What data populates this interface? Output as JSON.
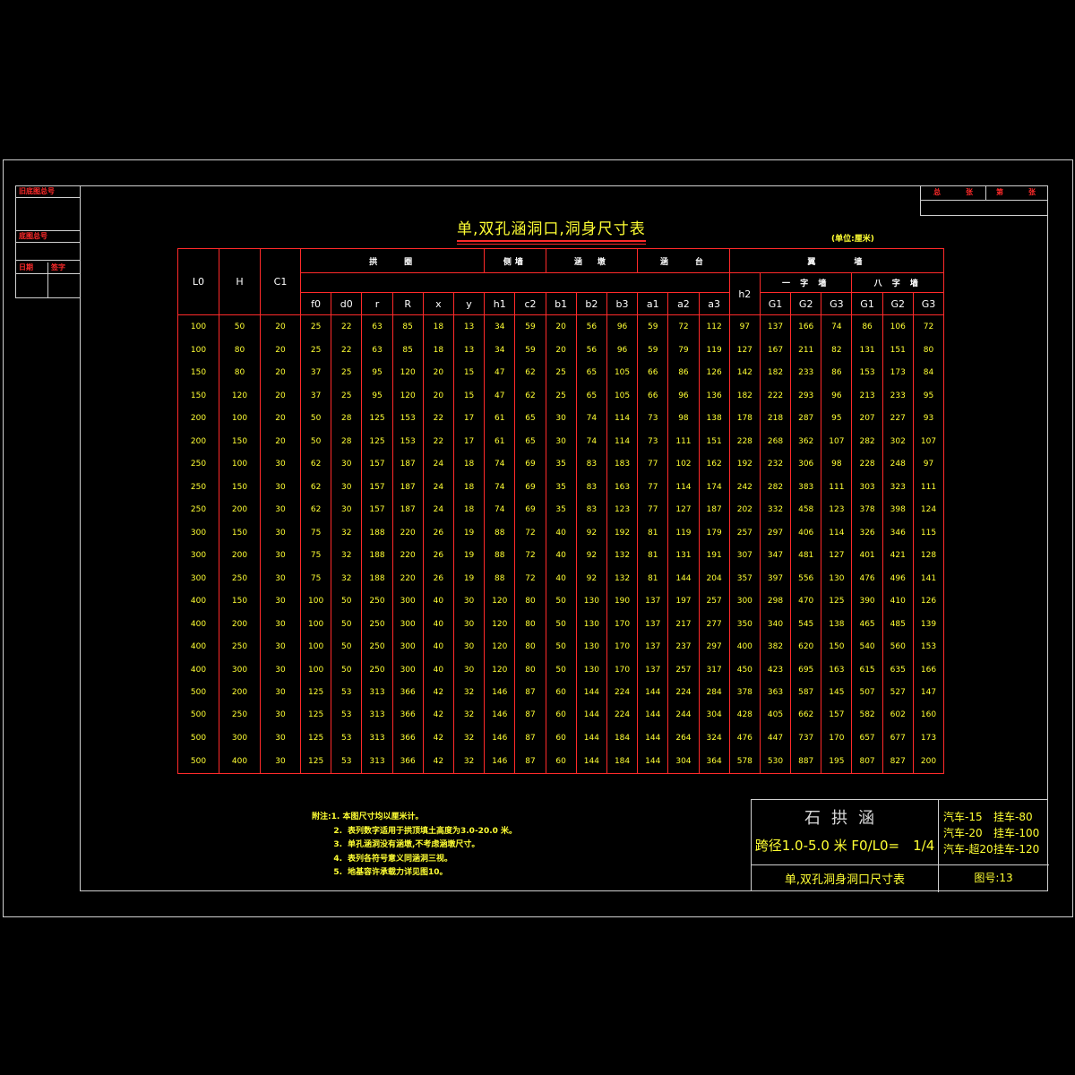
{
  "stamp": {
    "cell1": "旧底图总号",
    "cell2": "底图总号",
    "cell3a": "日期",
    "cell3b": "签字"
  },
  "top_right": {
    "label1": "总",
    "label2": "张",
    "label3": "第",
    "label4": "张"
  },
  "title": "单,双孔涵洞口,洞身尺寸表",
  "unit": "(单位:厘米)",
  "table": {
    "col_left": [
      "L0",
      "H",
      "C1"
    ],
    "groups": [
      "拱　　圈",
      "侧墙",
      "涵　墩",
      "涵　　台",
      "翼　　　墙"
    ],
    "wing_sub": [
      "一 字 墙",
      "八 字 墙"
    ],
    "cols": [
      "f0",
      "d0",
      "r",
      "R",
      "x",
      "y",
      "h1",
      "c2",
      "b1",
      "b2",
      "b3",
      "a1",
      "a2",
      "a3",
      "h2",
      "G1",
      "G2",
      "G3",
      "G1",
      "G2",
      "G3"
    ],
    "rows": [
      [
        "100",
        "50",
        "20",
        "25",
        "22",
        "63",
        "85",
        "18",
        "13",
        "34",
        "59",
        "20",
        "56",
        "96",
        "59",
        "72",
        "112",
        "97",
        "137",
        "166",
        "74",
        "86",
        "106",
        "72"
      ],
      [
        "100",
        "80",
        "20",
        "25",
        "22",
        "63",
        "85",
        "18",
        "13",
        "34",
        "59",
        "20",
        "56",
        "96",
        "59",
        "79",
        "119",
        "127",
        "167",
        "211",
        "82",
        "131",
        "151",
        "80"
      ],
      [
        "150",
        "80",
        "20",
        "37",
        "25",
        "95",
        "120",
        "20",
        "15",
        "47",
        "62",
        "25",
        "65",
        "105",
        "66",
        "86",
        "126",
        "142",
        "182",
        "233",
        "86",
        "153",
        "173",
        "84"
      ],
      [
        "150",
        "120",
        "20",
        "37",
        "25",
        "95",
        "120",
        "20",
        "15",
        "47",
        "62",
        "25",
        "65",
        "105",
        "66",
        "96",
        "136",
        "182",
        "222",
        "293",
        "96",
        "213",
        "233",
        "95"
      ],
      [
        "200",
        "100",
        "20",
        "50",
        "28",
        "125",
        "153",
        "22",
        "17",
        "61",
        "65",
        "30",
        "74",
        "114",
        "73",
        "98",
        "138",
        "178",
        "218",
        "287",
        "95",
        "207",
        "227",
        "93"
      ],
      [
        "200",
        "150",
        "20",
        "50",
        "28",
        "125",
        "153",
        "22",
        "17",
        "61",
        "65",
        "30",
        "74",
        "114",
        "73",
        "111",
        "151",
        "228",
        "268",
        "362",
        "107",
        "282",
        "302",
        "107"
      ],
      [
        "250",
        "100",
        "30",
        "62",
        "30",
        "157",
        "187",
        "24",
        "18",
        "74",
        "69",
        "35",
        "83",
        "183",
        "77",
        "102",
        "162",
        "192",
        "232",
        "306",
        "98",
        "228",
        "248",
        "97"
      ],
      [
        "250",
        "150",
        "30",
        "62",
        "30",
        "157",
        "187",
        "24",
        "18",
        "74",
        "69",
        "35",
        "83",
        "163",
        "77",
        "114",
        "174",
        "242",
        "282",
        "383",
        "111",
        "303",
        "323",
        "111"
      ],
      [
        "250",
        "200",
        "30",
        "62",
        "30",
        "157",
        "187",
        "24",
        "18",
        "74",
        "69",
        "35",
        "83",
        "123",
        "77",
        "127",
        "187",
        "202",
        "332",
        "458",
        "123",
        "378",
        "398",
        "124"
      ],
      [
        "300",
        "150",
        "30",
        "75",
        "32",
        "188",
        "220",
        "26",
        "19",
        "88",
        "72",
        "40",
        "92",
        "192",
        "81",
        "119",
        "179",
        "257",
        "297",
        "406",
        "114",
        "326",
        "346",
        "115"
      ],
      [
        "300",
        "200",
        "30",
        "75",
        "32",
        "188",
        "220",
        "26",
        "19",
        "88",
        "72",
        "40",
        "92",
        "132",
        "81",
        "131",
        "191",
        "307",
        "347",
        "481",
        "127",
        "401",
        "421",
        "128"
      ],
      [
        "300",
        "250",
        "30",
        "75",
        "32",
        "188",
        "220",
        "26",
        "19",
        "88",
        "72",
        "40",
        "92",
        "132",
        "81",
        "144",
        "204",
        "357",
        "397",
        "556",
        "130",
        "476",
        "496",
        "141"
      ],
      [
        "400",
        "150",
        "30",
        "100",
        "50",
        "250",
        "300",
        "40",
        "30",
        "120",
        "80",
        "50",
        "130",
        "190",
        "137",
        "197",
        "257",
        "300",
        "298",
        "470",
        "125",
        "390",
        "410",
        "126"
      ],
      [
        "400",
        "200",
        "30",
        "100",
        "50",
        "250",
        "300",
        "40",
        "30",
        "120",
        "80",
        "50",
        "130",
        "170",
        "137",
        "217",
        "277",
        "350",
        "340",
        "545",
        "138",
        "465",
        "485",
        "139"
      ],
      [
        "400",
        "250",
        "30",
        "100",
        "50",
        "250",
        "300",
        "40",
        "30",
        "120",
        "80",
        "50",
        "130",
        "170",
        "137",
        "237",
        "297",
        "400",
        "382",
        "620",
        "150",
        "540",
        "560",
        "153"
      ],
      [
        "400",
        "300",
        "30",
        "100",
        "50",
        "250",
        "300",
        "40",
        "30",
        "120",
        "80",
        "50",
        "130",
        "170",
        "137",
        "257",
        "317",
        "450",
        "423",
        "695",
        "163",
        "615",
        "635",
        "166"
      ],
      [
        "500",
        "200",
        "30",
        "125",
        "53",
        "313",
        "366",
        "42",
        "32",
        "146",
        "87",
        "60",
        "144",
        "224",
        "144",
        "224",
        "284",
        "378",
        "363",
        "587",
        "145",
        "507",
        "527",
        "147"
      ],
      [
        "500",
        "250",
        "30",
        "125",
        "53",
        "313",
        "366",
        "42",
        "32",
        "146",
        "87",
        "60",
        "144",
        "224",
        "144",
        "244",
        "304",
        "428",
        "405",
        "662",
        "157",
        "582",
        "602",
        "160"
      ],
      [
        "500",
        "300",
        "30",
        "125",
        "53",
        "313",
        "366",
        "42",
        "32",
        "146",
        "87",
        "60",
        "144",
        "184",
        "144",
        "264",
        "324",
        "476",
        "447",
        "737",
        "170",
        "657",
        "677",
        "173"
      ],
      [
        "500",
        "400",
        "30",
        "125",
        "53",
        "313",
        "366",
        "42",
        "32",
        "146",
        "87",
        "60",
        "144",
        "184",
        "144",
        "304",
        "364",
        "578",
        "530",
        "887",
        "195",
        "807",
        "827",
        "200"
      ]
    ]
  },
  "notes": {
    "prefix": "附注:",
    "items": [
      {
        "num": "1.",
        "text": "本图尺寸均以厘米计。"
      },
      {
        "num": "2.",
        "text": "表列数字适用于拱顶填土高度为3.0-20.0 米。"
      },
      {
        "num": "3.",
        "text": "单孔涵洞没有涵墩,不考虑涵墩尺寸。"
      },
      {
        "num": "4.",
        "text": "表列各符号意义同涵洞三视。"
      },
      {
        "num": "5.",
        "text": "地基容许承载力详见图10。"
      }
    ]
  },
  "title_block": {
    "name": "石拱涵",
    "span": "跨径1.0-5.0 米 F0/L0=　1/4",
    "subtitle": "单,双孔洞身洞口尺寸表",
    "loads": [
      [
        "汽车-15",
        "挂车-80"
      ],
      [
        "汽车-20",
        "挂车-100"
      ],
      [
        "汽车-超20",
        "挂车-120"
      ]
    ],
    "drawing_no": "图号:13"
  }
}
